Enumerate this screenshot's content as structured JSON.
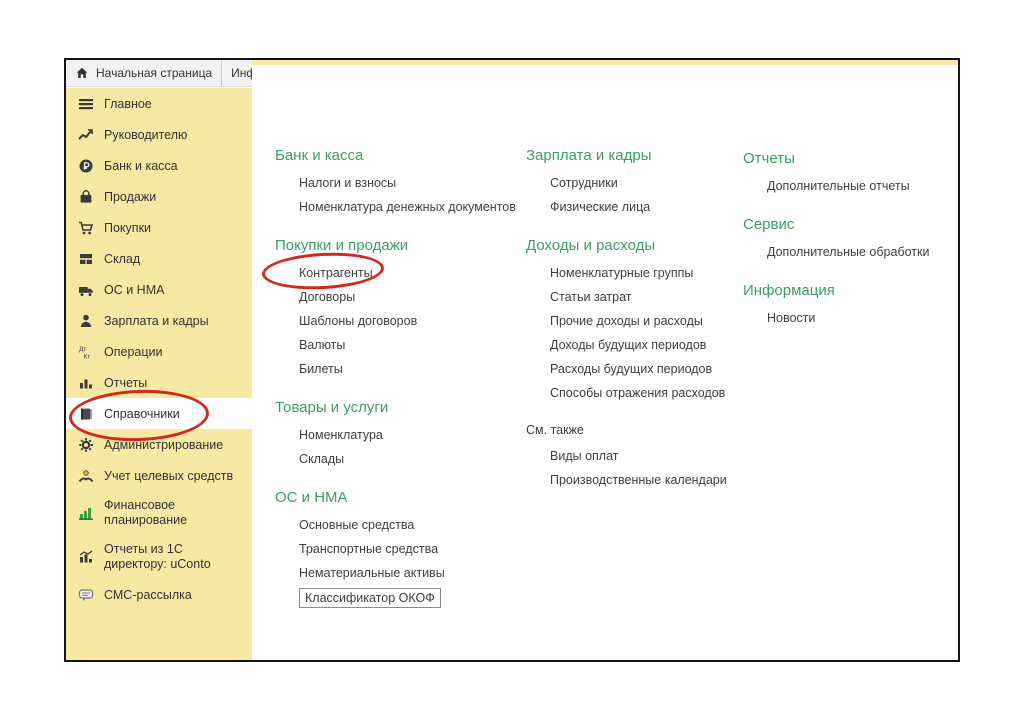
{
  "colors": {
    "sidebar_bg": "#f6e9a3",
    "section_header_green": "#3d9e63",
    "annotation_red": "#d3281e",
    "tabbar_bg": "#f2f2f2"
  },
  "tabs": {
    "home": "Начальная страница",
    "partial": "Инф"
  },
  "sidebar": {
    "items": [
      {
        "label": "Главное"
      },
      {
        "label": "Руководителю"
      },
      {
        "label": "Банк и касса"
      },
      {
        "label": "Продажи"
      },
      {
        "label": "Покупки"
      },
      {
        "label": "Склад"
      },
      {
        "label": "ОС и НМА"
      },
      {
        "label": "Зарплата и кадры"
      },
      {
        "label": "Операции",
        "icon_top": "Дт",
        "icon_bottom": "Кт"
      },
      {
        "label": "Отчеты"
      },
      {
        "label": "Справочники",
        "selected": true
      },
      {
        "label": "Администрирование"
      },
      {
        "label": "Учет целевых средств"
      },
      {
        "label": "Финансовое планирование"
      },
      {
        "label": "Отчеты из 1С директору: uConto"
      },
      {
        "label": "СМС-рассылка"
      }
    ]
  },
  "menu": {
    "columns": [
      {
        "sections": [
          {
            "title": "Банк и касса",
            "items": [
              "Налоги и взносы",
              "Номенклатура денежных документов"
            ]
          },
          {
            "title": "Покупки и продажи",
            "items": [
              "Контрагенты",
              "Договоры",
              "Шаблоны договоров",
              "Валюты",
              "Билеты"
            ]
          },
          {
            "title": "Товары и услуги",
            "items": [
              "Номенклатура",
              "Склады"
            ]
          },
          {
            "title": "ОС и НМА",
            "items": [
              "Основные средства",
              "Транспортные средства",
              "Нематериальные активы",
              "Классификатор ОКОФ"
            ]
          }
        ]
      },
      {
        "sections": [
          {
            "title": "Зарплата и кадры",
            "items": [
              "Сотрудники",
              "Физические лица"
            ]
          },
          {
            "title": "Доходы и расходы",
            "items": [
              "Номенклатурные группы",
              "Статьи затрат",
              "Прочие доходы и расходы",
              "Доходы будущих периодов",
              "Расходы будущих периодов",
              "Способы отражения расходов"
            ]
          },
          {
            "title": "См. также",
            "plain": true,
            "items": [
              "Виды оплат",
              "Производственные календари"
            ]
          }
        ]
      },
      {
        "sections": [
          {
            "title": "Отчеты",
            "items": [
              "Дополнительные отчеты"
            ]
          },
          {
            "title": "Сервис",
            "items": [
              "Дополнительные обработки"
            ]
          },
          {
            "title": "Информация",
            "items": [
              "Новости"
            ]
          }
        ]
      }
    ]
  },
  "annotations": {
    "circle_1_target": "Справочники",
    "circle_2_target": "Контрагенты"
  }
}
